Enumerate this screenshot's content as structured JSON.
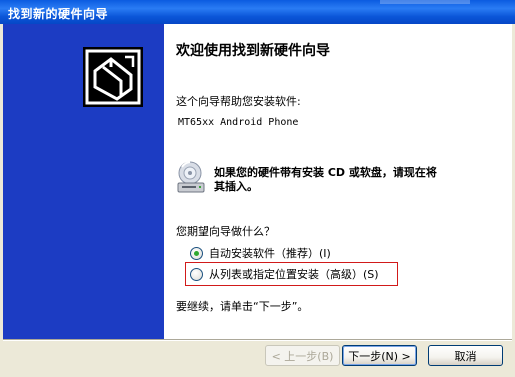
{
  "window": {
    "title": "找到新的硬件向导"
  },
  "wizard": {
    "heading": "欢迎使用找到新硬件向导",
    "intro": "这个向导帮助您安装软件:",
    "device_name": "MT65xx Android Phone",
    "cd_prompt_line1": "如果您的硬件带有安装 CD 或软盘，请现在将",
    "cd_prompt_line2": "其插入。",
    "question": "您期望向导做什么？",
    "options": [
      {
        "label": "自动安装软件（推荐）(I)",
        "selected": true
      },
      {
        "label": "从列表或指定位置安装（高级）(S)",
        "selected": false
      }
    ],
    "continue_hint": "要继续，请单击“下一步”。"
  },
  "buttons": {
    "back": "< 上一步(B)",
    "next": "下一步(N) >",
    "cancel": "取消"
  },
  "colors": {
    "side_panel": "#1c3cc3",
    "title_bar": "#0b5be0",
    "highlight": "#d11a1a",
    "radio_selected": "#2fa82f"
  },
  "icons": {
    "hardware": "hardware-wizard-icon",
    "cd": "cd-drive-icon"
  }
}
